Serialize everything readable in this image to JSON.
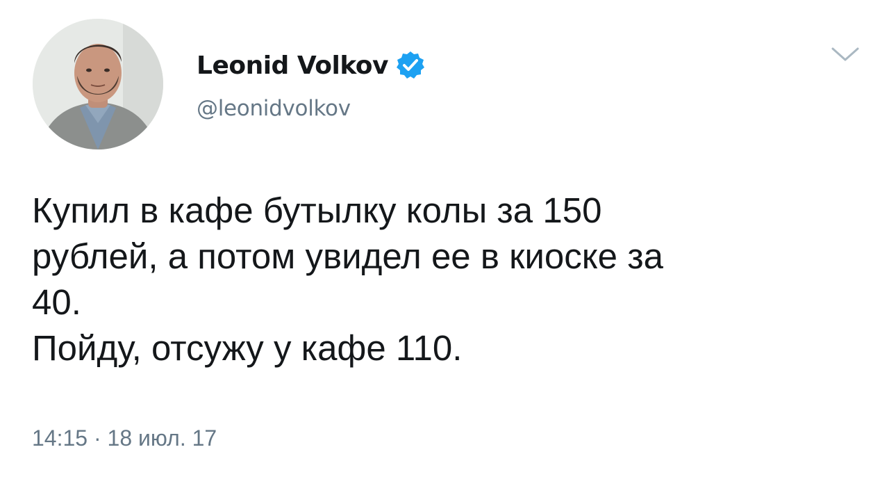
{
  "author": {
    "display_name": "Leonid Volkov",
    "handle": "@leonidvolkov",
    "verified": true,
    "avatar_icon": "profile-photo"
  },
  "tweet": {
    "lines": [
      "Купил в кафе бутылку колы за 150",
      "рублей, а потом увидел ее в киоске за",
      "40.",
      "Пойду, отсужу у кафе 110."
    ],
    "time": "14:15",
    "separator": "·",
    "date": "18 июл. 17"
  },
  "icons": {
    "verified": "verified-badge-icon",
    "menu": "chevron-down-icon"
  },
  "colors": {
    "verified_blue": "#1da1f2",
    "text_primary": "#14171a",
    "text_secondary": "#657786",
    "caret": "#aab8c2"
  }
}
